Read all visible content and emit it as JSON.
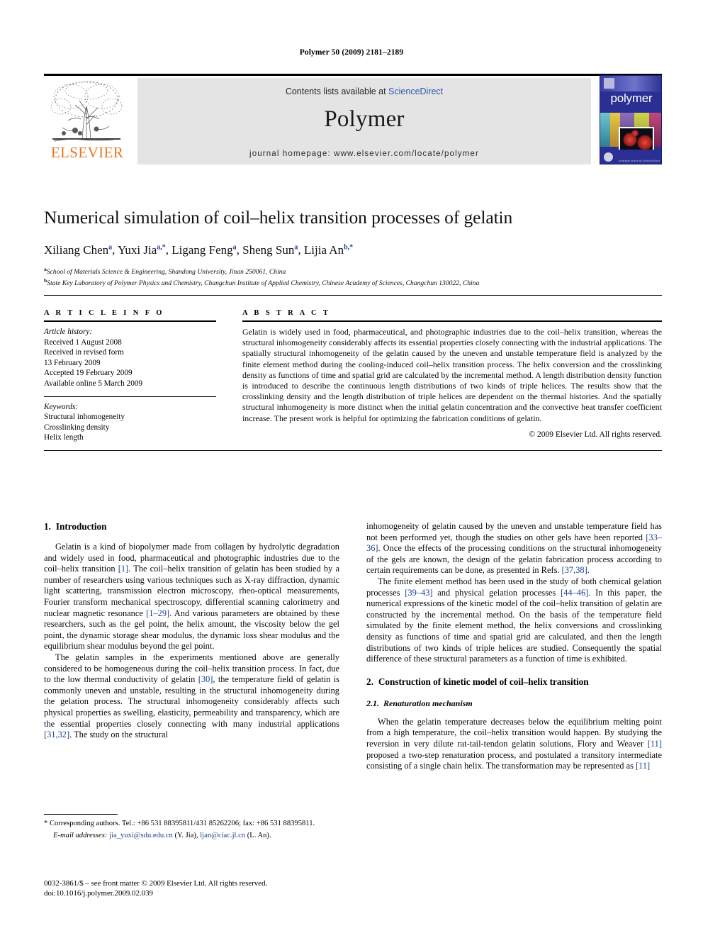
{
  "running_head": "Polymer 50 (2009) 2181–2189",
  "masthead": {
    "publisher_name": "ELSEVIER",
    "contents_prefix": "Contents lists available at ",
    "sciencedirect": "ScienceDirect",
    "journal_name": "Polymer",
    "homepage": "journal homepage: www.elsevier.com/locate/polymer",
    "cover_title": "polymer",
    "cover_footer": "available online at\nScienceDirect"
  },
  "article": {
    "title": "Numerical simulation of coil–helix transition processes of gelatin",
    "authors": [
      {
        "name": "Xiliang Chen",
        "sup": "a",
        "sep": ", "
      },
      {
        "name": "Yuxi Jia",
        "sup": "a,*",
        "sep": ", "
      },
      {
        "name": "Ligang Feng",
        "sup": "a",
        "sep": ", "
      },
      {
        "name": "Sheng Sun",
        "sup": "a",
        "sep": ", "
      },
      {
        "name": "Lijia An",
        "sup": "b,*",
        "sep": ""
      }
    ],
    "affiliations": [
      {
        "mark": "a",
        "text": "School of Materials Science & Engineering, Shandong University, Jinan 250061, China"
      },
      {
        "mark": "b",
        "text": "State Key Laboratory of Polymer Physics and Chemistry, Changchun Institute of Applied Chemistry, Chinese Academy of Sciences, Changchun 130022, China"
      }
    ]
  },
  "article_info": {
    "heading": "A R T I C L E   I N F O",
    "history_label": "Article history:",
    "history": [
      "Received 1 August 2008",
      "Received in revised form",
      "13 February 2009",
      "Accepted 19 February 2009",
      "Available online 5 March 2009"
    ],
    "keywords_label": "Keywords:",
    "keywords": [
      "Structural inhomogeneity",
      "Crosslinking density",
      "Helix length"
    ]
  },
  "abstract": {
    "heading": "A B S T R A C T",
    "text": "Gelatin is widely used in food, pharmaceutical, and photographic industries due to the coil–helix transition, whereas the structural inhomogeneity considerably affects its essential properties closely connecting with the industrial applications. The spatially structural inhomogeneity of the gelatin caused by the uneven and unstable temperature field is analyzed by the finite element method during the cooling-induced coil–helix transition process. The helix conversion and the crosslinking density as functions of time and spatial grid are calculated by the incremental method. A length distribution density function is introduced to describe the continuous length distributions of two kinds of triple helices. The results show that the crosslinking density and the length distribution of triple helices are dependent on the thermal histories. And the spatially structural inhomogeneity is more distinct when the initial gelatin concentration and the convective heat transfer coefficient increase. The present work is helpful for optimizing the fabrication conditions of gelatin.",
    "copyright": "© 2009 Elsevier Ltd. All rights reserved."
  },
  "body": {
    "intro_heading_num": "1.",
    "intro_heading_text": "Introduction",
    "intro_p1": "Gelatin is a kind of biopolymer made from collagen by hydrolytic degradation and widely used in food, pharmaceutical and photographic industries due to the coil–helix transition [1]. The coil–helix transition of gelatin has been studied by a number of researchers using various techniques such as X-ray diffraction, dynamic light scattering, transmission electron microscopy, rheo-optical measurements, Fourier transform mechanical spectroscopy, differential scanning calorimetry and nuclear magnetic resonance [1–29]. And various parameters are obtained by these researchers, such as the gel point, the helix amount, the viscosity below the gel point, the dynamic storage shear modulus, the dynamic loss shear modulus and the equilibrium shear modulus beyond the gel point.",
    "intro_p2": "The gelatin samples in the experiments mentioned above are generally considered to be homogeneous during the coil–helix transition process. In fact, due to the low thermal conductivity of gelatin [30], the temperature field of gelatin is commonly uneven and unstable, resulting in the structural inhomogeneity during the gelation process. The structural inhomogeneity considerably affects such physical properties as swelling, elasticity, permeability and transparency, which are the essential properties closely connecting with many industrial applications [31,32]. The study on the structural",
    "intro_p2_cont": "inhomogeneity of gelatin caused by the uneven and unstable temperature field has not been performed yet, though the studies on other gels have been reported [33–36]. Once the effects of the processing conditions on the structural inhomogeneity of the gels are known, the design of the gelatin fabrication process according to certain requirements can be done, as presented in Refs. [37,38].",
    "intro_p3": "The finite element method has been used in the study of both chemical gelation processes [39–43] and physical gelation processes [44–46]. In this paper, the numerical expressions of the kinetic model of the coil–helix transition of gelatin are constructed by the incremental method. On the basis of the temperature field simulated by the finite element method, the helix conversions and crosslinking density as functions of time and spatial grid are calculated, and then the length distributions of two kinds of triple helices are studied. Consequently the spatial difference of these structural parameters as a function of time is exhibited.",
    "sec2_num": "2.",
    "sec2_text": "Construction of kinetic model of coil–helix transition",
    "sec21_num": "2.1.",
    "sec21_text": "Renaturation mechanism",
    "sec21_p1": "When the gelatin temperature decreases below the equilibrium melting point from a high temperature, the coil–helix transition would happen. By studying the reversion in very dilute rat-tail-tendon gelatin solutions, Flory and Weaver [11] proposed a two-step renaturation process, and postulated a transitory intermediate consisting of a single chain helix. The transformation may be represented as [11]"
  },
  "footnote": {
    "corresponding": "* Corresponding authors. Tel.: +86 531 88395811/431 85262206; fax: +86 531 88395811.",
    "email_label": "E-mail addresses:",
    "email1": "jia_yuxi@sdu.edu.cn",
    "email1_who": "(Y. Jia),",
    "email2": "ljan@ciac.jl.cn",
    "email2_who": "(L. An)."
  },
  "imprint": {
    "line1": "0032-3861/$ – see front matter © 2009 Elsevier Ltd. All rights reserved.",
    "line2": "doi:10.1016/j.polymer.2009.02.039"
  },
  "colors": {
    "link": "#1b3f8f",
    "sciencedirect": "#2b57a8",
    "elsevier_orange": "#E87722",
    "cover_blue": "#2b2f93",
    "masthead_bg": "#e4e4e4"
  }
}
